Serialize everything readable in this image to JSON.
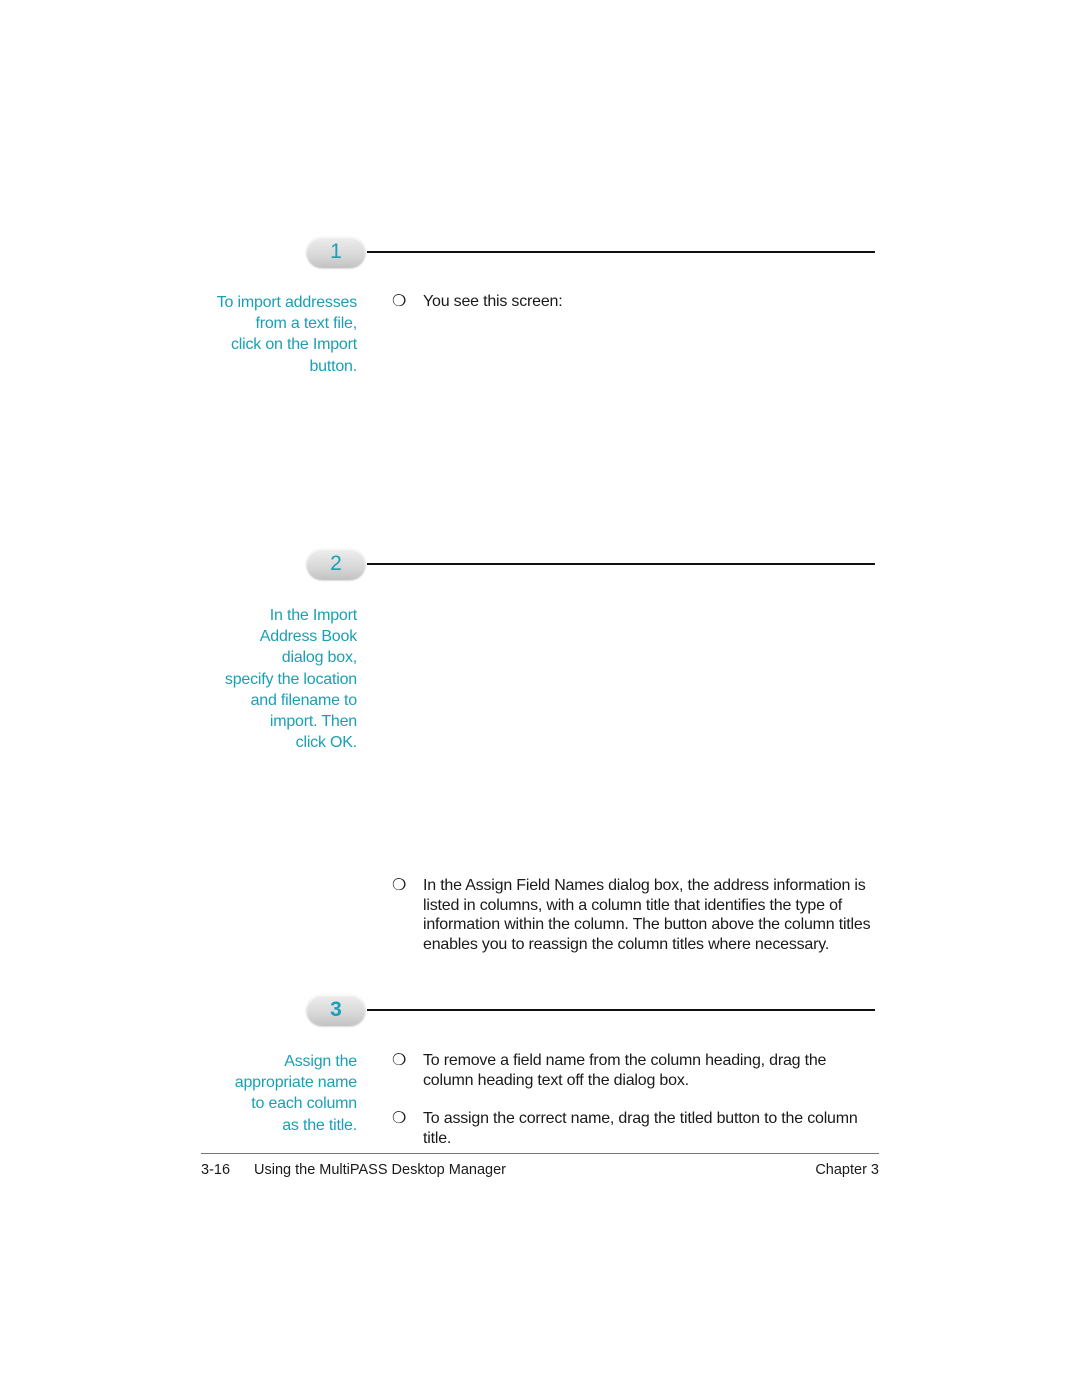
{
  "steps": [
    {
      "number": "1",
      "side_note": [
        "To import addresses",
        "from a text file,",
        "click on the Import",
        "button."
      ],
      "bullets": [
        "You see this screen:"
      ]
    },
    {
      "number": "2",
      "side_note": [
        "In the Import",
        "Address Book",
        "dialog box,",
        "specify the location",
        "and filename to",
        "import. Then",
        "click OK."
      ],
      "bullets": [
        "In the Assign Field Names dialog box, the address information is listed in columns, with a column title that identifies the type of information within the column. The button above the column titles enables you to reassign the column titles where necessary."
      ]
    },
    {
      "number": "3",
      "side_note": [
        "Assign the",
        "appropriate name",
        "to each column",
        "as the title."
      ],
      "bullets": [
        "To remove a field name from the column heading, drag the column heading text off the dialog box.",
        "To assign the correct name, drag the titled button to the column title."
      ]
    }
  ],
  "bullet_glyph": "❍",
  "footer": {
    "page_number": "3-16",
    "book_title": "Using the MultiPASS Desktop Manager",
    "chapter": "Chapter 3"
  },
  "colors": {
    "accent": "#1a9fb5",
    "text": "#1a1a1a"
  }
}
